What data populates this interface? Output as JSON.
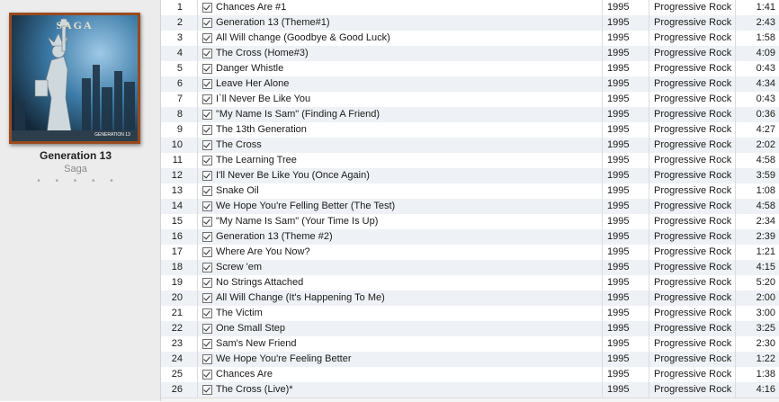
{
  "album": {
    "title": "Generation 13",
    "artist": "Saga",
    "rating_dots": "• • • • •",
    "art": {
      "logo": "SAGA",
      "caption": "GENERATION 13",
      "frame_color": "#9a4a1f"
    }
  },
  "tracks": [
    {
      "num": "1",
      "name": "Chances Are #1",
      "year": "1995",
      "genre": "Progressive Rock",
      "time": "1:41"
    },
    {
      "num": "2",
      "name": "Generation 13 (Theme#1)",
      "year": "1995",
      "genre": "Progressive Rock",
      "time": "2:43"
    },
    {
      "num": "3",
      "name": "All Will change (Goodbye & Good Luck)",
      "year": "1995",
      "genre": "Progressive Rock",
      "time": "1:58"
    },
    {
      "num": "4",
      "name": "The Cross (Home#3)",
      "year": "1995",
      "genre": "Progressive Rock",
      "time": "4:09"
    },
    {
      "num": "5",
      "name": "Danger Whistle",
      "year": "1995",
      "genre": "Progressive Rock",
      "time": "0:43"
    },
    {
      "num": "6",
      "name": "Leave Her Alone",
      "year": "1995",
      "genre": "Progressive Rock",
      "time": "4:34"
    },
    {
      "num": "7",
      "name": "I`ll Never Be Like You",
      "year": "1995",
      "genre": "Progressive Rock",
      "time": "0:43"
    },
    {
      "num": "8",
      "name": "\"My Name Is Sam\" (Finding A Friend)",
      "year": "1995",
      "genre": "Progressive Rock",
      "time": "0:36"
    },
    {
      "num": "9",
      "name": "The 13th Generation",
      "year": "1995",
      "genre": "Progressive Rock",
      "time": "4:27"
    },
    {
      "num": "10",
      "name": "The Cross",
      "year": "1995",
      "genre": "Progressive Rock",
      "time": "2:02"
    },
    {
      "num": "11",
      "name": "The Learning Tree",
      "year": "1995",
      "genre": "Progressive Rock",
      "time": "4:58"
    },
    {
      "num": "12",
      "name": "I'll Never Be Like You (Once Again)",
      "year": "1995",
      "genre": "Progressive Rock",
      "time": "3:59"
    },
    {
      "num": "13",
      "name": "Snake Oil",
      "year": "1995",
      "genre": "Progressive Rock",
      "time": "1:08"
    },
    {
      "num": "14",
      "name": "We Hope You're Felling Better (The Test)",
      "year": "1995",
      "genre": "Progressive Rock",
      "time": "4:58"
    },
    {
      "num": "15",
      "name": "\"My Name Is Sam\" (Your Time Is Up)",
      "year": "1995",
      "genre": "Progressive Rock",
      "time": "2:34"
    },
    {
      "num": "16",
      "name": "Generation 13 (Theme #2)",
      "year": "1995",
      "genre": "Progressive Rock",
      "time": "2:39"
    },
    {
      "num": "17",
      "name": "Where Are You Now?",
      "year": "1995",
      "genre": "Progressive Rock",
      "time": "1:21"
    },
    {
      "num": "18",
      "name": "Screw 'em",
      "year": "1995",
      "genre": "Progressive Rock",
      "time": "4:15"
    },
    {
      "num": "19",
      "name": "No Strings Attached",
      "year": "1995",
      "genre": "Progressive Rock",
      "time": "5:20"
    },
    {
      "num": "20",
      "name": "All Will Change (It's Happening To Me)",
      "year": "1995",
      "genre": "Progressive Rock",
      "time": "2:00"
    },
    {
      "num": "21",
      "name": "The Victim",
      "year": "1995",
      "genre": "Progressive Rock",
      "time": "3:00"
    },
    {
      "num": "22",
      "name": "One Small Step",
      "year": "1995",
      "genre": "Progressive Rock",
      "time": "3:25"
    },
    {
      "num": "23",
      "name": "Sam's New Friend",
      "year": "1995",
      "genre": "Progressive Rock",
      "time": "2:30"
    },
    {
      "num": "24",
      "name": "We Hope You're Feeling Better",
      "year": "1995",
      "genre": "Progressive Rock",
      "time": "1:22"
    },
    {
      "num": "25",
      "name": "Chances Are",
      "year": "1995",
      "genre": "Progressive Rock",
      "time": "1:38"
    },
    {
      "num": "26",
      "name": "The Cross (Live)*",
      "year": "1995",
      "genre": "Progressive Rock",
      "time": "4:16"
    }
  ],
  "colors": {
    "row_alt": "#eef1f5",
    "panel_bg": "#ececec"
  }
}
